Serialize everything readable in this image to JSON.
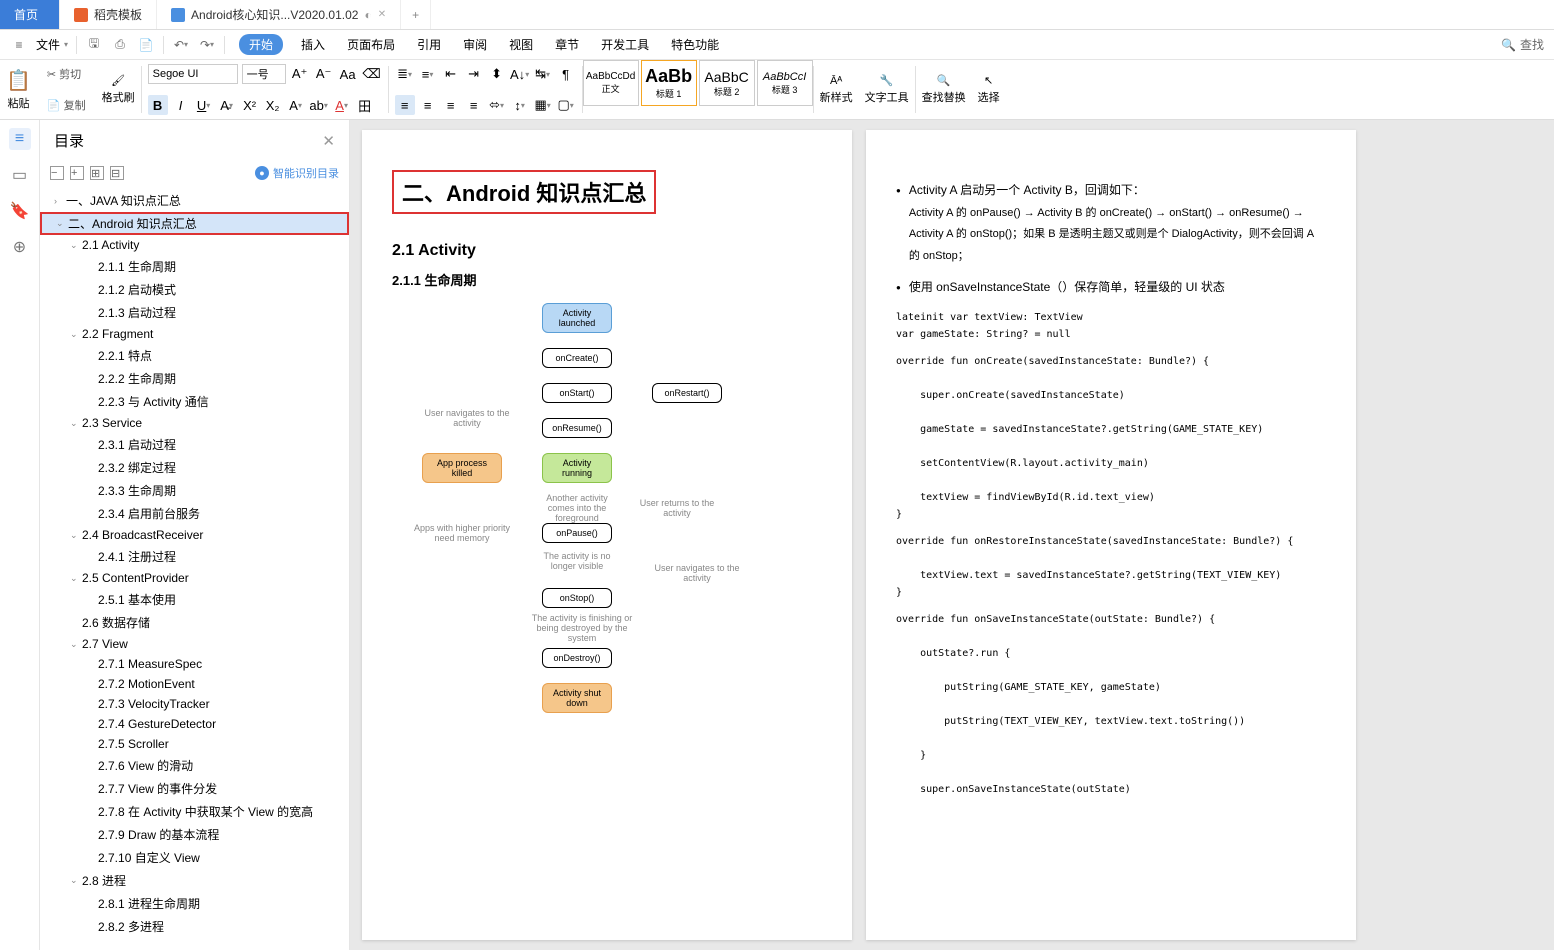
{
  "tabs": {
    "home": "首页",
    "doc1": "稻壳模板",
    "doc2": "Android核心知识...V2020.01.02"
  },
  "menu": {
    "file": "文件"
  },
  "ribbon": {
    "start": "开始",
    "insert": "插入",
    "layout": "页面布局",
    "ref": "引用",
    "review": "审阅",
    "view": "视图",
    "chapter": "章节",
    "dev": "开发工具",
    "special": "特色功能",
    "search": "查找"
  },
  "tb": {
    "paste": "粘贴",
    "cut": "剪切",
    "copy": "复制",
    "fmt": "格式刷",
    "font": "Segoe UI",
    "size": "一号",
    "style_body": "AaBbCcDd",
    "style_body_lbl": "正文",
    "style_h1": "AaBb",
    "style_h1_lbl": "标题 1",
    "style_h2": "AaBbC",
    "style_h2_lbl": "标题 2",
    "style_h3": "AaBbCcI",
    "style_h3_lbl": "标题 3",
    "newstyle": "新样式",
    "texttool": "文字工具",
    "findreplace": "查找替换",
    "select": "选择"
  },
  "outline": {
    "title": "目录",
    "smart": "智能识别目录"
  },
  "tree": [
    {
      "l": 1,
      "chev": ">",
      "t": "一、JAVA 知识点汇总"
    },
    {
      "l": 1,
      "chev": "v",
      "t": "二、Android 知识点汇总",
      "sel": true
    },
    {
      "l": 2,
      "chev": "v",
      "t": "2.1 Activity"
    },
    {
      "l": 3,
      "t": "2.1.1 生命周期"
    },
    {
      "l": 3,
      "t": "2.1.2 启动模式"
    },
    {
      "l": 3,
      "t": "2.1.3 启动过程"
    },
    {
      "l": 2,
      "chev": "v",
      "t": "2.2 Fragment"
    },
    {
      "l": 3,
      "t": "2.2.1 特点"
    },
    {
      "l": 3,
      "t": "2.2.2 生命周期"
    },
    {
      "l": 3,
      "t": "2.2.3 与 Activity 通信"
    },
    {
      "l": 2,
      "chev": "v",
      "t": "2.3 Service"
    },
    {
      "l": 3,
      "t": "2.3.1 启动过程"
    },
    {
      "l": 3,
      "t": "2.3.2 绑定过程"
    },
    {
      "l": 3,
      "t": "2.3.3 生命周期"
    },
    {
      "l": 3,
      "t": "2.3.4 启用前台服务"
    },
    {
      "l": 2,
      "chev": "v",
      "t": "2.4 BroadcastReceiver"
    },
    {
      "l": 3,
      "t": "2.4.1 注册过程"
    },
    {
      "l": 2,
      "chev": "v",
      "t": "2.5 ContentProvider"
    },
    {
      "l": 3,
      "t": "2.5.1 基本使用"
    },
    {
      "l": 2,
      "t": "2.6 数据存储"
    },
    {
      "l": 2,
      "chev": "v",
      "t": "2.7 View"
    },
    {
      "l": 3,
      "t": "2.7.1 MeasureSpec"
    },
    {
      "l": 3,
      "t": "2.7.2 MotionEvent"
    },
    {
      "l": 3,
      "t": "2.7.3 VelocityTracker"
    },
    {
      "l": 3,
      "t": "2.7.4 GestureDetector"
    },
    {
      "l": 3,
      "t": "2.7.5 Scroller"
    },
    {
      "l": 3,
      "t": "2.7.6 View 的滑动"
    },
    {
      "l": 3,
      "t": "2.7.7 View 的事件分发"
    },
    {
      "l": 3,
      "t": "2.7.8 在 Activity 中获取某个 View 的宽高"
    },
    {
      "l": 3,
      "t": "2.7.9 Draw 的基本流程"
    },
    {
      "l": 3,
      "t": "2.7.10 自定义 View"
    },
    {
      "l": 2,
      "chev": "v",
      "t": "2.8 进程"
    },
    {
      "l": 3,
      "t": "2.8.1 进程生命周期"
    },
    {
      "l": 3,
      "t": "2.8.2 多进程"
    }
  ],
  "doc": {
    "h1": "二、Android 知识点汇总",
    "h2": "2.1 Activity",
    "h3": "2.1.1 生命周期",
    "fc": {
      "launched": "Activity\nlaunched",
      "oncreate": "onCreate()",
      "onstart": "onStart()",
      "onresume": "onResume()",
      "running": "Activity\nrunning",
      "onpause": "onPause()",
      "onstop": "onStop()",
      "ondestroy": "onDestroy()",
      "shutdown": "Activity\nshut down",
      "onrestart": "onRestart()",
      "killed": "App process\nkilled",
      "nav": "User navigates\nto the activity",
      "fore": "Another activity comes\ninto the foreground",
      "ret": "User returns\nto the activity",
      "novis": "The activity is\nno longer visible",
      "navto": "User navigates\nto the activity",
      "finish": "The activity is finishing or\nbeing destroyed by the system",
      "prio": "Apps with higher priority\nneed memory"
    },
    "bullets": [
      "Activity A 启动另一个 Activity B，回调如下：",
      "使用 onSaveInstanceState（）保存简单，轻量级的 UI 状态"
    ],
    "b1_detail": "Activity A 的 onPause() → Activity B 的 onCreate() → onStart() → onResume() → Activity A 的 onStop()；如果 B 是透明主题又或则是个 DialogActivity，则不会回调 A 的 onStop；",
    "code1": "lateinit var textView: TextView\nvar gameState: String? = null",
    "code2": "override fun onCreate(savedInstanceState: Bundle?) {\n\n    super.onCreate(savedInstanceState)\n\n    gameState = savedInstanceState?.getString(GAME_STATE_KEY)\n\n    setContentView(R.layout.activity_main)\n\n    textView = findViewById(R.id.text_view)\n}",
    "code3": "override fun onRestoreInstanceState(savedInstanceState: Bundle?) {\n\n    textView.text = savedInstanceState?.getString(TEXT_VIEW_KEY)\n}",
    "code4": "override fun onSaveInstanceState(outState: Bundle?) {\n\n    outState?.run {\n\n        putString(GAME_STATE_KEY, gameState)\n\n        putString(TEXT_VIEW_KEY, textView.text.toString())\n\n    }\n\n    super.onSaveInstanceState(outState)"
  }
}
